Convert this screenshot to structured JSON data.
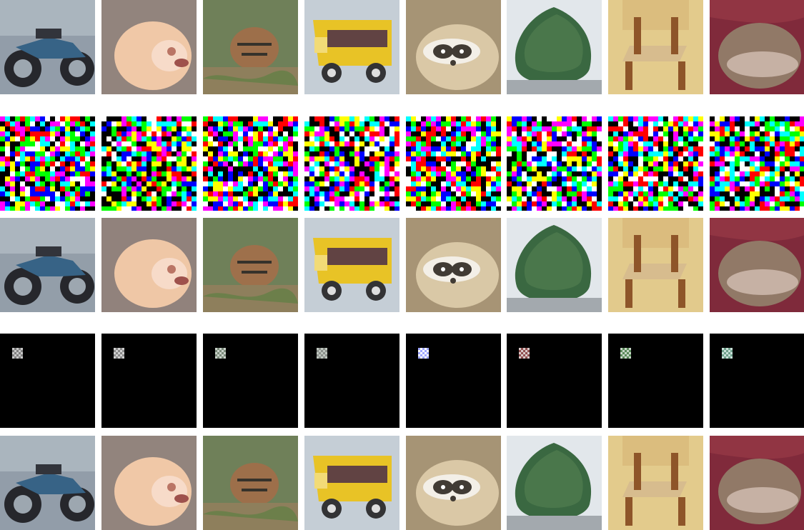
{
  "rows": [
    {
      "kind": "natural",
      "tiles": [
        {
          "subject": "motorcycle",
          "icon": "motorcycle-icon",
          "bg": "#8e9aa6",
          "accent": "#2f5d82",
          "detail": "#1e1f24"
        },
        {
          "subject": "hamster",
          "icon": "hamster-icon",
          "bg": "#8e7f78",
          "accent": "#f0c6a4",
          "detail": "#b8705f"
        },
        {
          "subject": "tiger",
          "icon": "tiger-icon",
          "bg": "#73805b",
          "accent": "#9a6a43",
          "detail": "#2e2a23"
        },
        {
          "subject": "school-bus",
          "icon": "bus-icon",
          "bg": "#b0bcc7",
          "accent": "#e8c11e",
          "detail": "#2b2b2d"
        },
        {
          "subject": "raccoon",
          "icon": "raccoon-icon",
          "bg": "#a39070",
          "accent": "#d9c6a3",
          "detail": "#3a332c"
        },
        {
          "subject": "tree",
          "icon": "tree-icon",
          "bg": "#d7dde3",
          "accent": "#32623a",
          "detail": "#4d7b49"
        },
        {
          "subject": "chair",
          "icon": "chair-icon",
          "bg": "#e2c988",
          "accent": "#8a4f21",
          "detail": "#d6ba8a"
        },
        {
          "subject": "hedgehog",
          "icon": "hedgehog-icon",
          "bg": "#7b2233",
          "accent": "#8d7461",
          "detail": "#d7c1b7"
        }
      ]
    },
    {
      "kind": "noise",
      "tiles": [
        {
          "subject": "noise-1",
          "icon": "noise-pattern-icon",
          "bg": "#000000",
          "accent": "#ff00ff",
          "detail": "#00ff00"
        },
        {
          "subject": "noise-2",
          "icon": "noise-pattern-icon",
          "bg": "#000000",
          "accent": "#00ffff",
          "detail": "#ff0000"
        },
        {
          "subject": "noise-3",
          "icon": "noise-pattern-icon",
          "bg": "#000000",
          "accent": "#00ff00",
          "detail": "#ffffff"
        },
        {
          "subject": "noise-4",
          "icon": "noise-pattern-icon",
          "bg": "#000000",
          "accent": "#0000ff",
          "detail": "#ffff00"
        },
        {
          "subject": "noise-5",
          "icon": "noise-pattern-icon",
          "bg": "#000000",
          "accent": "#ff00ff",
          "detail": "#00ff00"
        },
        {
          "subject": "noise-6",
          "icon": "noise-pattern-icon",
          "bg": "#000000",
          "accent": "#00ff00",
          "detail": "#ff00ff"
        },
        {
          "subject": "noise-7",
          "icon": "noise-pattern-icon",
          "bg": "#000000",
          "accent": "#0000ff",
          "detail": "#ffffff"
        },
        {
          "subject": "noise-8",
          "icon": "noise-pattern-icon",
          "bg": "#000000",
          "accent": "#00ffff",
          "detail": "#ff0000"
        }
      ]
    },
    {
      "kind": "natural",
      "tiles": [
        {
          "subject": "motorcycle",
          "icon": "motorcycle-icon",
          "bg": "#8f9ba6",
          "accent": "#2f5d82",
          "detail": "#1e1f24"
        },
        {
          "subject": "hamster",
          "icon": "hamster-icon",
          "bg": "#8d7d77",
          "accent": "#efc5a3",
          "detail": "#b8705f"
        },
        {
          "subject": "tiger",
          "icon": "tiger-icon",
          "bg": "#757f5b",
          "accent": "#9b6b44",
          "detail": "#2e2a23"
        },
        {
          "subject": "school-bus",
          "icon": "bus-icon",
          "bg": "#b1bdc8",
          "accent": "#e8c11e",
          "detail": "#2b2b2d"
        },
        {
          "subject": "raccoon",
          "icon": "raccoon-icon",
          "bg": "#a49070",
          "accent": "#d8c6a3",
          "detail": "#3a332c"
        },
        {
          "subject": "tree",
          "icon": "tree-icon",
          "bg": "#d8dee4",
          "accent": "#32623a",
          "detail": "#4d7b49"
        },
        {
          "subject": "chair",
          "icon": "chair-icon",
          "bg": "#e1c888",
          "accent": "#8a4f21",
          "detail": "#d6ba8a"
        },
        {
          "subject": "hedgehog",
          "icon": "hedgehog-icon",
          "bg": "#7a2233",
          "accent": "#8d7461",
          "detail": "#d7c1b7"
        }
      ]
    },
    {
      "kind": "black",
      "tiles": [
        {
          "subject": "patch-1",
          "icon": "patch-icon",
          "bg": "#000000",
          "accent": "#c8c8c8",
          "detail": "#808080"
        },
        {
          "subject": "patch-2",
          "icon": "patch-icon",
          "bg": "#000000",
          "accent": "#d0d0d0",
          "detail": "#8a8a8a"
        },
        {
          "subject": "patch-3",
          "icon": "patch-icon",
          "bg": "#000000",
          "accent": "#c8d0c8",
          "detail": "#7a8a7a"
        },
        {
          "subject": "patch-4",
          "icon": "patch-icon",
          "bg": "#000000",
          "accent": "#bfc6bf",
          "detail": "#8a8f8a"
        },
        {
          "subject": "patch-5",
          "icon": "patch-icon",
          "bg": "#000000",
          "accent": "#9fa7ff",
          "detail": "#ffffff"
        },
        {
          "subject": "patch-6",
          "icon": "patch-icon",
          "bg": "#000000",
          "accent": "#d8c8c8",
          "detail": "#905050"
        },
        {
          "subject": "patch-7",
          "icon": "patch-icon",
          "bg": "#000000",
          "accent": "#c6d6c6",
          "detail": "#5a8a5a"
        },
        {
          "subject": "patch-8",
          "icon": "patch-icon",
          "bg": "#000000",
          "accent": "#c8e0d8",
          "detail": "#6fa08c"
        }
      ]
    },
    {
      "kind": "natural",
      "tiles": [
        {
          "subject": "motorcycle",
          "icon": "motorcycle-icon",
          "bg": "#8e9aa6",
          "accent": "#2f5d82",
          "detail": "#1e1f24"
        },
        {
          "subject": "hamster",
          "icon": "hamster-icon",
          "bg": "#8e7f78",
          "accent": "#f0c6a4",
          "detail": "#b8705f"
        },
        {
          "subject": "tiger",
          "icon": "tiger-icon",
          "bg": "#73805b",
          "accent": "#9a6a43",
          "detail": "#2e2a23"
        },
        {
          "subject": "school-bus",
          "icon": "bus-icon",
          "bg": "#b0bcc7",
          "accent": "#e8c11e",
          "detail": "#2b2b2d"
        },
        {
          "subject": "raccoon",
          "icon": "raccoon-icon",
          "bg": "#a39070",
          "accent": "#d9c6a3",
          "detail": "#3a332c"
        },
        {
          "subject": "tree",
          "icon": "tree-icon",
          "bg": "#d7dde3",
          "accent": "#32623a",
          "detail": "#4d7b49"
        },
        {
          "subject": "chair",
          "icon": "chair-icon",
          "bg": "#e2c988",
          "accent": "#8a4f21",
          "detail": "#d6ba8a"
        },
        {
          "subject": "hedgehog",
          "icon": "hedgehog-icon",
          "bg": "#7b2233",
          "accent": "#8d7461",
          "detail": "#d7c1b7"
        }
      ]
    }
  ]
}
